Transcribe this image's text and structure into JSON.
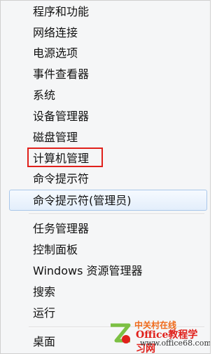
{
  "menu": {
    "items": [
      {
        "label": "程序和功能"
      },
      {
        "label": "网络连接"
      },
      {
        "label": "电源选项"
      },
      {
        "label": "事件查看器"
      },
      {
        "label": "系统"
      },
      {
        "label": "设备管理器"
      },
      {
        "label": "磁盘管理"
      },
      {
        "label": "计算机管理"
      },
      {
        "label": "命令提示符"
      },
      {
        "label": "命令提示符(管理员)"
      },
      {
        "label": "任务管理器"
      },
      {
        "label": "控制面板"
      },
      {
        "label": "Windows 资源管理器"
      },
      {
        "label": "搜索"
      },
      {
        "label": "运行"
      },
      {
        "label": "桌面"
      }
    ]
  },
  "watermark": {
    "brand": "中关村在线",
    "title": "Office教程学习网",
    "url": "www.office68.com",
    "color_primary": "#e0201b",
    "color_secondary": "#ef6a1a"
  },
  "colors": {
    "highlight_border": "#e0201b",
    "hover_border": "#a9c7ea",
    "hover_fill": "#e3eefb"
  }
}
